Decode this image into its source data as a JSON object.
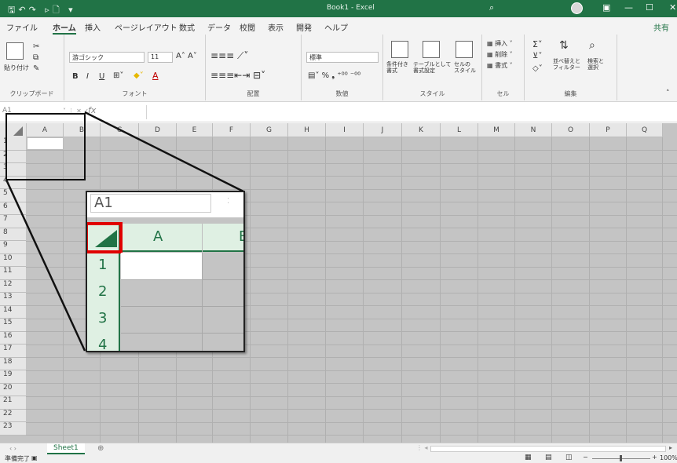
{
  "titlebar": {
    "title": "Book1  -  Excel"
  },
  "menu": [
    "ファイル",
    "ホーム",
    "挿入",
    "ページレイアウト",
    "数式",
    "データ",
    "校閲",
    "表示",
    "開発",
    "ヘルプ"
  ],
  "share": "共有",
  "ribbon": {
    "clipboard": {
      "paste": "貼り付け",
      "label": "クリップボード"
    },
    "font": {
      "name": "游ゴシック",
      "size": "11",
      "label": "フォント",
      "bold": "B",
      "italic": "I",
      "underline": "U"
    },
    "alignment": {
      "label": "配置"
    },
    "number": {
      "format": "標準",
      "label": "数値"
    },
    "styles": {
      "cond": "条件付き\n書式",
      "table": "テーブルとして\n書式設定",
      "cell": "セルの\nスタイル",
      "label": "スタイル"
    },
    "cells": {
      "insert": "挿入",
      "delete": "削除",
      "format": "書式",
      "label": "セル"
    },
    "editing": {
      "sort": "並べ替えと\nフィルター",
      "find": "検索と\n選択",
      "label": "編集"
    }
  },
  "namebox": "A1",
  "fx": "fx",
  "columns": [
    "A",
    "B",
    "C",
    "D",
    "E",
    "F",
    "G",
    "H",
    "I",
    "J",
    "K",
    "L",
    "M",
    "N",
    "O",
    "P",
    "Q"
  ],
  "rows": [
    "1",
    "2",
    "3",
    "4",
    "5",
    "6",
    "7",
    "8",
    "9",
    "10",
    "11",
    "12",
    "13",
    "14",
    "15",
    "16",
    "17",
    "18",
    "19",
    "20",
    "21",
    "22",
    "23"
  ],
  "sheet_tab": "Sheet1",
  "status": "準備完了",
  "zoom_pct": "100%",
  "zoom_view": {
    "namebox": "A1",
    "col": "A",
    "col2": "B",
    "rows": [
      "1",
      "2",
      "3",
      "4"
    ]
  },
  "colors": {
    "excel_green": "#217346",
    "highlight": "#e00000"
  }
}
